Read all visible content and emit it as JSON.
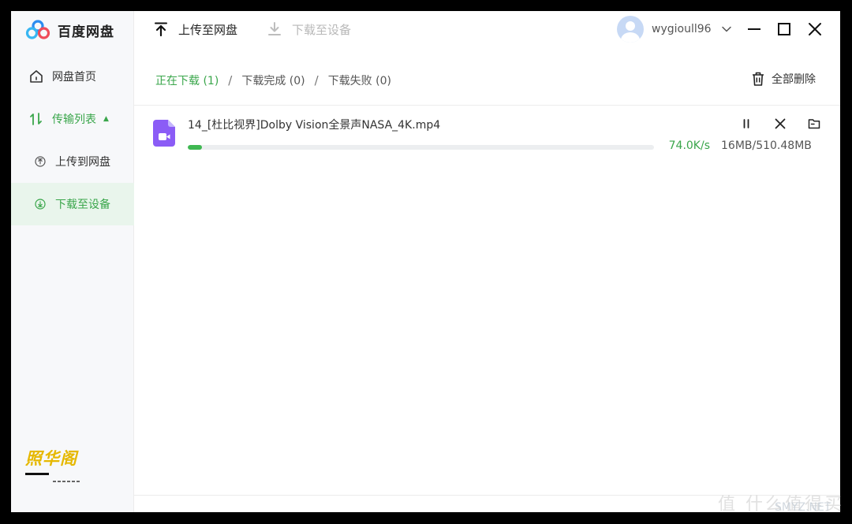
{
  "app": {
    "name": "百度网盘"
  },
  "sidebar": {
    "home": "网盘首页",
    "transfer": "传输列表",
    "upload": "上传到网盘",
    "download": "下载至设备"
  },
  "topbar": {
    "upload": "上传至网盘",
    "download": "下载至设备",
    "username": "wygioull96"
  },
  "tabs": {
    "downloading": "正在下载 (1)",
    "completed": "下载完成 (0)",
    "failed": "下载失败 (0)",
    "separator": "/"
  },
  "actions": {
    "delete_all": "全部删除"
  },
  "download_item": {
    "filename": "14_[杜比视界]Dolby Vision全景声NASA_4K.mp4",
    "speed": "74.0K/s",
    "size": "16MB/510.48MB",
    "progress_percent": 3.13
  },
  "colors": {
    "accent": "#3aa64b",
    "progress": "#3fb852",
    "file_icon": "#8b5cf6"
  },
  "watermarks": {
    "logo_text": "照华阁",
    "site_text": "值 什么值得买",
    "site_domain": "SMYZ.NET"
  },
  "icons": {
    "brand": "baidu-netdisk-logo",
    "home": "home-icon",
    "transfer": "transfer-icon",
    "upload": "upload-icon",
    "download": "download-icon",
    "video_file": "video-file-icon",
    "pause": "pause-icon",
    "cancel": "close-icon",
    "folder": "folder-icon",
    "trash": "trash-icon"
  }
}
